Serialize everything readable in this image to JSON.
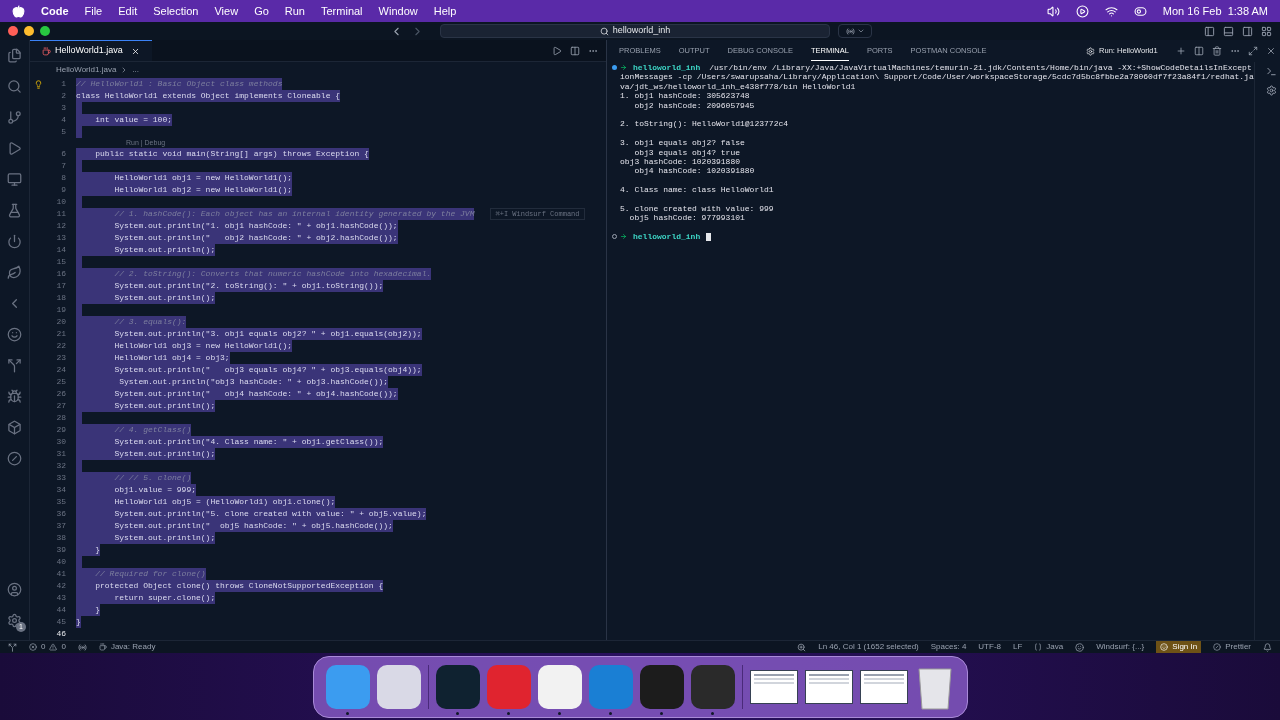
{
  "menu_bar": {
    "app": "Code",
    "items": [
      "File",
      "Edit",
      "Selection",
      "View",
      "Go",
      "Run",
      "Terminal",
      "Window",
      "Help"
    ],
    "clock": "Mon 16 Feb  1:38 AM"
  },
  "title_bar": {
    "search": "helloworld_inh"
  },
  "editor": {
    "tab": {
      "label": "HelloWorld1.java",
      "selected": true
    },
    "breadcrumb": [
      "HelloWorld1.java",
      "..."
    ],
    "lines": [
      {
        "n": "1",
        "kind": "comment",
        "text": "// HelloWorld1 : Basic Object class methods",
        "selected": true,
        "bulb": true
      },
      {
        "n": "2",
        "kind": "code",
        "text": "class HelloWorld1 extends Object implements Cloneable {",
        "selected": true
      },
      {
        "n": "3",
        "kind": "blank",
        "selected": true
      },
      {
        "n": "4",
        "kind": "code",
        "text": "    int value = 100;",
        "selected": true
      },
      {
        "n": "5",
        "kind": "blank",
        "selected": true
      },
      {
        "n": "6",
        "kind": "code",
        "text": "    public static void main(String[] args) throws Exception {",
        "selected": true,
        "codelens": "Run | Debug"
      },
      {
        "n": "7",
        "kind": "blank",
        "selected": true
      },
      {
        "n": "8",
        "kind": "code",
        "text": "        HelloWorld1 obj1 = new HelloWorld1();",
        "selected": true
      },
      {
        "n": "9",
        "kind": "code",
        "text": "        HelloWorld1 obj2 = new HelloWorld1();",
        "selected": true
      },
      {
        "n": "10",
        "kind": "blank",
        "selected": true
      },
      {
        "n": "11",
        "kind": "comment",
        "text": "        // 1. hashCode(): Each object has an internal identity generated by the JVM",
        "selected": true,
        "hint": "⌘+I Windsurf Command"
      },
      {
        "n": "12",
        "kind": "code",
        "text": "        System.out.println(\"1. obj1 hashCode: \" + obj1.hashCode());",
        "selected": true
      },
      {
        "n": "13",
        "kind": "code",
        "text": "        System.out.println(\"   obj2 hashCode: \" + obj2.hashCode());",
        "selected": true
      },
      {
        "n": "14",
        "kind": "code",
        "text": "        System.out.println();",
        "selected": true
      },
      {
        "n": "15",
        "kind": "blank",
        "selected": true
      },
      {
        "n": "16",
        "kind": "comment",
        "text": "        // 2. toString(): Converts that numeric hashCode into hexadecimal.",
        "selected": true
      },
      {
        "n": "17",
        "kind": "code",
        "text": "        System.out.println(\"2. toString(): \" + obj1.toString());",
        "selected": true
      },
      {
        "n": "18",
        "kind": "code",
        "text": "        System.out.println();",
        "selected": true
      },
      {
        "n": "19",
        "kind": "blank",
        "selected": true
      },
      {
        "n": "20",
        "kind": "comment",
        "text": "        // 3. equals():",
        "selected": true
      },
      {
        "n": "21",
        "kind": "code",
        "text": "        System.out.println(\"3. obj1 equals obj2? \" + obj1.equals(obj2));",
        "selected": true
      },
      {
        "n": "22",
        "kind": "code",
        "text": "        HelloWorld1 obj3 = new HelloWorld1();",
        "selected": true
      },
      {
        "n": "23",
        "kind": "code",
        "text": "        HelloWorld1 obj4 = obj3;",
        "selected": true
      },
      {
        "n": "24",
        "kind": "code",
        "text": "        System.out.println(\"   obj3 equals obj4? \" + obj3.equals(obj4));",
        "selected": true
      },
      {
        "n": "25",
        "kind": "code",
        "text": "         System.out.println(\"obj3 hashCode: \" + obj3.hashCode());",
        "selected": true
      },
      {
        "n": "26",
        "kind": "code",
        "text": "        System.out.println(\"   obj4 hashCode: \" + obj4.hashCode());",
        "selected": true
      },
      {
        "n": "27",
        "kind": "code",
        "text": "        System.out.println();",
        "selected": true
      },
      {
        "n": "28",
        "kind": "blank",
        "selected": true
      },
      {
        "n": "29",
        "kind": "comment",
        "text": "        // 4. getClass()",
        "selected": true
      },
      {
        "n": "30",
        "kind": "code",
        "text": "        System.out.println(\"4. Class name: \" + obj1.getClass());",
        "selected": true
      },
      {
        "n": "31",
        "kind": "code",
        "text": "        System.out.println();",
        "selected": true
      },
      {
        "n": "32",
        "kind": "blank",
        "selected": true
      },
      {
        "n": "33",
        "kind": "comment",
        "text": "        // // 5. clone()",
        "selected": true
      },
      {
        "n": "34",
        "kind": "code",
        "text": "        obj1.value = 999;",
        "selected": true
      },
      {
        "n": "35",
        "kind": "code",
        "text": "        HelloWorld1 obj5 = (HelloWorld1) obj1.clone();",
        "selected": true
      },
      {
        "n": "36",
        "kind": "code",
        "text": "        System.out.println(\"5. clone created with value: \" + obj5.value);",
        "selected": true
      },
      {
        "n": "37",
        "kind": "code",
        "text": "        System.out.println(\"  obj5 hashCode: \" + obj5.hashCode());",
        "selected": true
      },
      {
        "n": "38",
        "kind": "code",
        "text": "        System.out.println();",
        "selected": true
      },
      {
        "n": "39",
        "kind": "code",
        "text": "    }",
        "selected": true
      },
      {
        "n": "40",
        "kind": "blank",
        "selected": true
      },
      {
        "n": "41",
        "kind": "comment",
        "text": "    // Required for clone()",
        "selected": true
      },
      {
        "n": "42",
        "kind": "code",
        "text": "    protected Object clone() throws CloneNotSupportedException {",
        "selected": true
      },
      {
        "n": "43",
        "kind": "code",
        "text": "        return super.clone();",
        "selected": true
      },
      {
        "n": "44",
        "kind": "code",
        "text": "    }",
        "selected": true
      },
      {
        "n": "45",
        "kind": "code",
        "text": "}",
        "selected": true
      },
      {
        "n": "46",
        "kind": "blank",
        "selected": false
      }
    ]
  },
  "activity_bar": {
    "settings_badge": "1"
  },
  "panel": {
    "tabs": [
      {
        "label": "PROBLEMS",
        "selected": false
      },
      {
        "label": "OUTPUT",
        "selected": false
      },
      {
        "label": "DEBUG CONSOLE",
        "selected": false
      },
      {
        "label": "TERMINAL",
        "selected": true
      },
      {
        "label": "PORTS",
        "selected": false
      },
      {
        "label": "POSTMAN CONSOLE",
        "selected": false
      }
    ],
    "session": "Run: HelloWorld1",
    "lines": [
      {
        "kind": "command",
        "finished": true,
        "prompt": "helloworld_inh",
        "text": "/usr/bin/env /Library/Java/JavaVirtualMachines/temurin-21.jdk/Contents/Home/bin/java -XX:+ShowCodeDetailsInExcept"
      },
      {
        "kind": "output",
        "text": "ionMessages -cp /Users/swarupsaha/Library/Application\\ Support/Code/User/workspaceStorage/5cdc7d5bc8fbbe2a78060df7f23a84f1/redhat.ja"
      },
      {
        "kind": "output",
        "text": "va/jdt_ws/helloworld_inh_e438f778/bin HelloWorld1"
      },
      {
        "kind": "output",
        "text": "1. obj1 hashCode: 305623748"
      },
      {
        "kind": "output",
        "text": "   obj2 hashCode: 2096057945"
      },
      {
        "kind": "blank"
      },
      {
        "kind": "output",
        "text": "2. toString(): HelloWorld1@123772c4"
      },
      {
        "kind": "blank"
      },
      {
        "kind": "output",
        "text": "3. obj1 equals obj2? false"
      },
      {
        "kind": "output",
        "text": "   obj3 equals obj4? true"
      },
      {
        "kind": "output",
        "text": "obj3 hashCode: 1020391880"
      },
      {
        "kind": "output",
        "text": "   obj4 hashCode: 1020391880"
      },
      {
        "kind": "blank"
      },
      {
        "kind": "output",
        "text": "4. Class name: class HelloWorld1"
      },
      {
        "kind": "blank"
      },
      {
        "kind": "output",
        "text": "5. clone created with value: 999"
      },
      {
        "kind": "output",
        "text": "  obj5 hashCode: 977993101"
      },
      {
        "kind": "blank"
      },
      {
        "kind": "command",
        "finished": false,
        "prompt": "helloworld_inh"
      }
    ]
  },
  "status_bar": {
    "errors": "0",
    "warnings": "0",
    "java": "Java: Ready",
    "position": "Ln 46, Col 1 (1652 selected)",
    "spaces": "Spaces: 4",
    "encoding": "UTF-8",
    "eol": "LF",
    "language": "Java",
    "windsurf": "Windsurf: {...}",
    "sign_in": "Sign In",
    "prettier": "Prettier"
  },
  "dock": {
    "items": [
      {
        "kind": "app",
        "color": "#3b9cf0",
        "running": true
      },
      {
        "kind": "app",
        "color": "#d9d9e6",
        "running": false
      },
      {
        "kind": "separator"
      },
      {
        "kind": "app",
        "color": "#0f2230",
        "running": true
      },
      {
        "kind": "app",
        "color": "#e0242f",
        "running": true
      },
      {
        "kind": "app",
        "color": "#f2f2f2",
        "running": true
      },
      {
        "kind": "app",
        "color": "#1a7fd4",
        "running": true
      },
      {
        "kind": "app",
        "color": "#1c1c1c",
        "running": true
      },
      {
        "kind": "app",
        "color": "#2a2a2a",
        "running": true
      },
      {
        "kind": "separator"
      },
      {
        "kind": "window"
      },
      {
        "kind": "window"
      },
      {
        "kind": "window"
      },
      {
        "kind": "trash"
      }
    ]
  }
}
